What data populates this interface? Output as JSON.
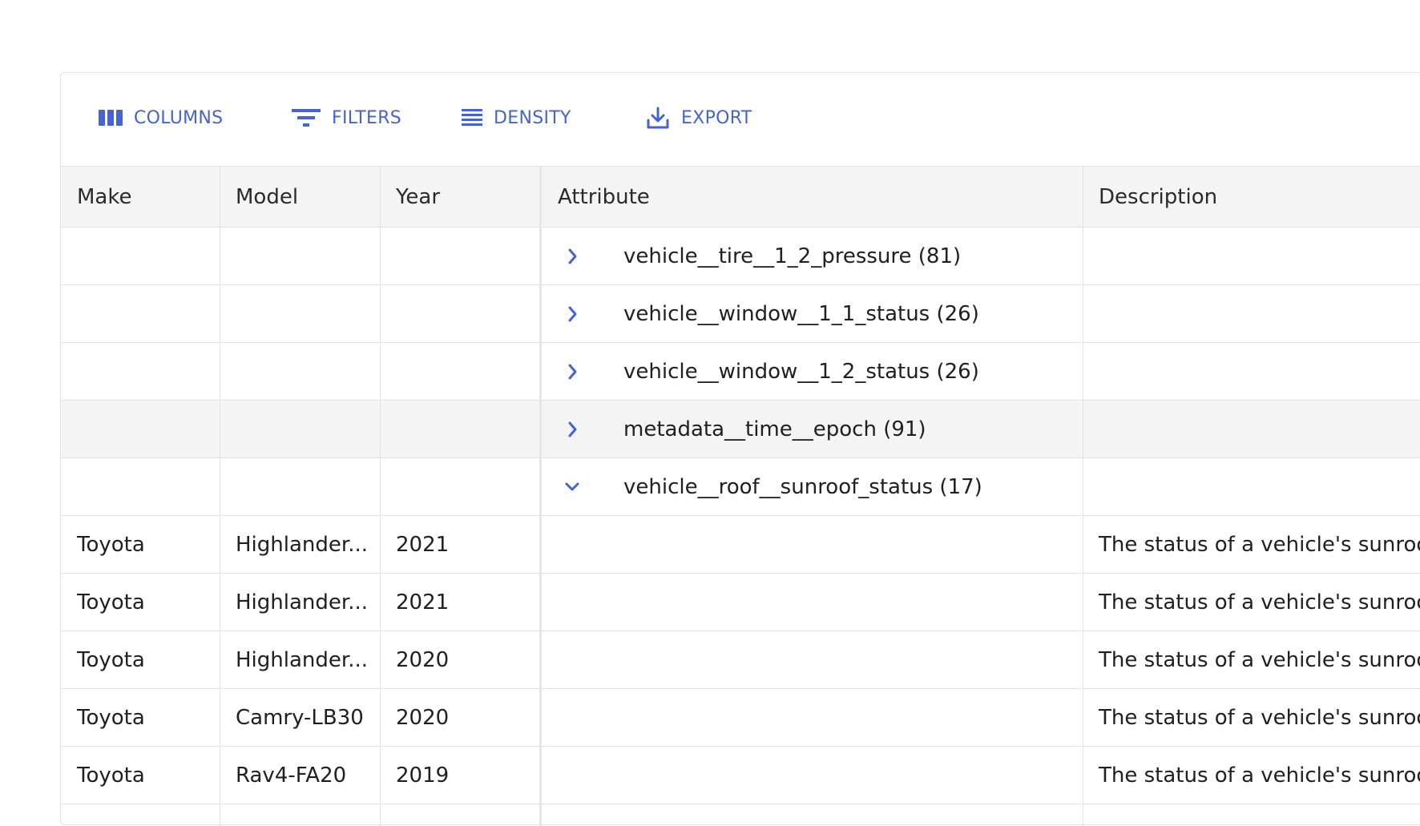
{
  "toolbar": {
    "columns_label": "COLUMNS",
    "filters_label": "FILTERS",
    "density_label": "DENSITY",
    "export_label": "EXPORT"
  },
  "columns": {
    "make": "Make",
    "model": "Model",
    "year": "Year",
    "attribute": "Attribute",
    "description": "Description"
  },
  "group_rows": [
    {
      "label": "vehicle__tire__1_2_pressure (81)",
      "expanded": false
    },
    {
      "label": "vehicle__window__1_1_status (26)",
      "expanded": false
    },
    {
      "label": "vehicle__window__1_2_status (26)",
      "expanded": false
    },
    {
      "label": "metadata__time__epoch (91)",
      "expanded": false
    },
    {
      "label": "vehicle__roof__sunroof_status (17)",
      "expanded": true
    }
  ],
  "data_rows": [
    {
      "make": "Toyota",
      "model": "Highlander...",
      "year": "2021",
      "attribute": "",
      "description": "The status of a vehicle's sunroof"
    },
    {
      "make": "Toyota",
      "model": "Highlander...",
      "year": "2021",
      "attribute": "",
      "description": "The status of a vehicle's sunroof"
    },
    {
      "make": "Toyota",
      "model": "Highlander...",
      "year": "2020",
      "attribute": "",
      "description": "The status of a vehicle's sunroof"
    },
    {
      "make": "Toyota",
      "model": "Camry-LB30",
      "year": "2020",
      "attribute": "",
      "description": "The status of a vehicle's sunroof"
    },
    {
      "make": "Toyota",
      "model": "Rav4-FA20",
      "year": "2019",
      "attribute": "",
      "description": "The status of a vehicle's sunroof"
    }
  ],
  "colors": {
    "accent": "#4662d3",
    "header_bg": "#f4f4f4",
    "border": "#e3e3e3"
  }
}
